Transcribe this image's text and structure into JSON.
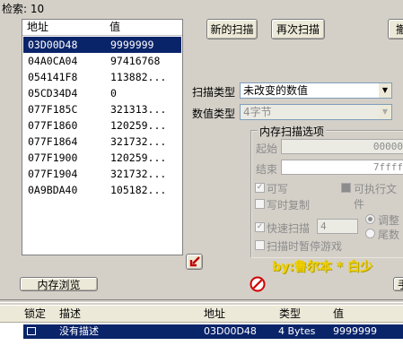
{
  "found": {
    "label": "检索: 10"
  },
  "results_list": {
    "columns": [
      "地址",
      "值"
    ],
    "rows": [
      {
        "address": "03D00D48",
        "value": "9999999"
      },
      {
        "address": "04A0CA04",
        "value": "97416768"
      },
      {
        "address": "054141F8",
        "value": "113882..."
      },
      {
        "address": "05CD34D4",
        "value": "0"
      },
      {
        "address": "077F185C",
        "value": "321313..."
      },
      {
        "address": "077F1860",
        "value": "120259..."
      },
      {
        "address": "077F1864",
        "value": "321732..."
      },
      {
        "address": "077F1900",
        "value": "120259..."
      },
      {
        "address": "077F1904",
        "value": "321732..."
      },
      {
        "address": "0A9BDA40",
        "value": "105182..."
      }
    ]
  },
  "buttons": {
    "new_scan": "新的扫描",
    "next_scan": "再次扫描",
    "undo_scan": "撤",
    "memory_view": "内存浏览",
    "add": "手"
  },
  "scan_type": {
    "label": "扫描类型",
    "value": "未改变的数值"
  },
  "value_type": {
    "label": "数值类型",
    "value": "4字节"
  },
  "mem_options": {
    "title": "内存扫描选项",
    "start_label": "起始",
    "start_value": "00000",
    "stop_label": "结束",
    "stop_value": "7ffff",
    "writable": "可写",
    "executable": "可执行文件",
    "copy_on_write": "写时复制",
    "fast_scan": "快速扫描",
    "fast_scan_value": "4",
    "align": "调整",
    "last_digits": "尾数",
    "pause_game": "扫描时暂停游戏"
  },
  "watermark": "by:鲁尔本 * 白少",
  "address_list": {
    "columns": [
      "锁定",
      "描述",
      "地址",
      "类型",
      "值"
    ],
    "rows": [
      {
        "description": "没有描述",
        "address": "03D00D48",
        "type": "4 Bytes",
        "value": "9999999"
      }
    ]
  },
  "colors": {
    "selection": "#0a246a",
    "face": "#d4d0c8",
    "watermark": "#f0d000"
  }
}
